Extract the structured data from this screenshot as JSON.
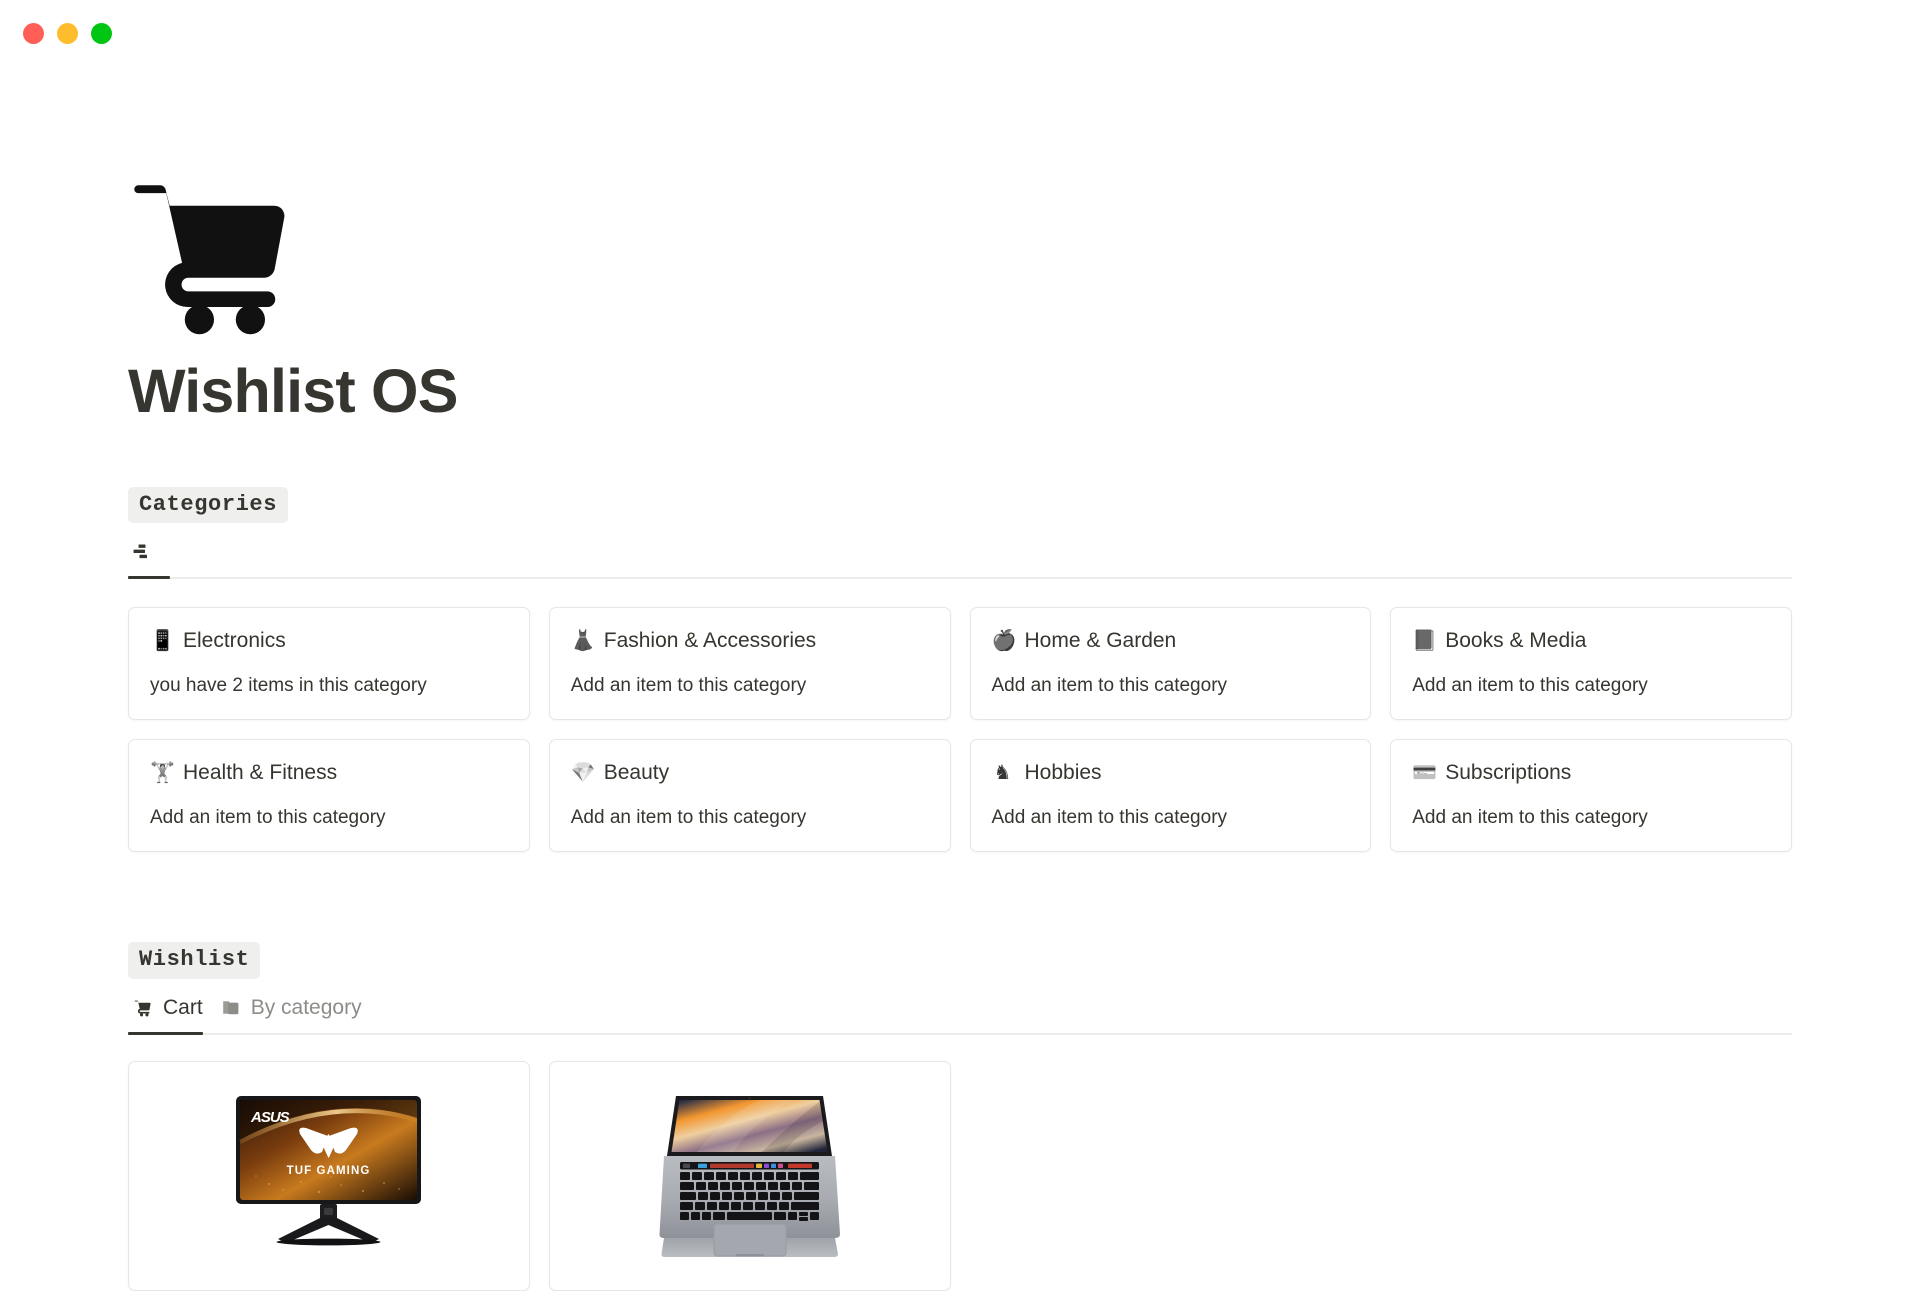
{
  "window": {
    "traffic_lights": [
      {
        "name": "close",
        "color": "#FF5F57"
      },
      {
        "name": "minimize",
        "color": "#FFBD2E"
      },
      {
        "name": "zoom",
        "color": "#00C613"
      }
    ]
  },
  "page": {
    "icon": "shopping-cart",
    "title": "Wishlist OS"
  },
  "categories_section": {
    "label": "Categories",
    "tabs": [
      {
        "id": "gallery",
        "icon": "gallery-icon",
        "label": "",
        "active": true
      }
    ],
    "cards": [
      {
        "emoji": "📱",
        "icon_name": "mobile-phone-icon",
        "name": "Electronics",
        "subtitle": "you have 2 items in this category"
      },
      {
        "emoji": "👗",
        "icon_name": "dress-icon",
        "name": "Fashion & Accessories",
        "subtitle": "Add an item to this category"
      },
      {
        "emoji": "🍎",
        "icon_name": "apple-icon",
        "name": "Home & Garden",
        "subtitle": "Add an item to this category"
      },
      {
        "emoji": "📕",
        "icon_name": "closed-book-icon",
        "name": "Books & Media",
        "subtitle": "Add an item to this category"
      },
      {
        "emoji": "🏋",
        "icon_name": "dumbbell-icon",
        "name": "Health & Fitness",
        "subtitle": "Add an item to this category"
      },
      {
        "emoji": "💎",
        "icon_name": "gem-icon",
        "name": "Beauty",
        "subtitle": "Add an item to this category"
      },
      {
        "emoji": "♞",
        "icon_name": "chess-knight-icon",
        "name": "Hobbies",
        "subtitle": "Add an item to this category"
      },
      {
        "emoji": "💳",
        "icon_name": "credit-card-icon",
        "name": "Subscriptions",
        "subtitle": "Add an item to this category"
      }
    ]
  },
  "wishlist_section": {
    "label": "Wishlist",
    "tabs": [
      {
        "id": "cart",
        "icon": "🛒",
        "icon_name": "shopping-cart-icon",
        "label": "Cart",
        "active": true
      },
      {
        "id": "by-category",
        "icon": "🗂",
        "icon_name": "card-index-dividers-icon",
        "label": "By category",
        "active": false
      }
    ],
    "items": [
      {
        "id": "asus-monitor",
        "image": "asus-tuf-gaming-monitor",
        "brand": "ASUS",
        "sub_brand": "TUF GAMING"
      },
      {
        "id": "macbook-pro",
        "image": "macbook-pro-laptop",
        "brand": "",
        "sub_brand": ""
      }
    ]
  },
  "colors": {
    "text": "#37352F",
    "muted": "#8C8C88",
    "border": "#E6E6E4",
    "chip_bg": "#EFEFEE",
    "divider": "#EDEDEC"
  }
}
